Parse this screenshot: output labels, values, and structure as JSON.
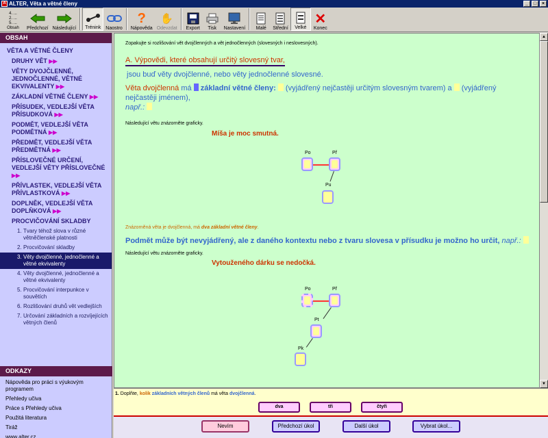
{
  "window": {
    "title": "ALTER, Věta a větné členy"
  },
  "toolbar": {
    "obsah_lines": [
      "4. ...",
      "2. ...",
      "5. ..."
    ],
    "obsah_label": "Obsah",
    "prev": "Předchozí",
    "next": "Následující",
    "trenink": "Trénink",
    "naostro": "Naostro",
    "napoveda": "Nápověda",
    "odevzdat": "Odevzdat",
    "export": "Export",
    "tisk": "Tisk",
    "nastaveni": "Nastavení",
    "male": "Malé",
    "stredni": "Střední",
    "velke": "Velké",
    "konec": "Konec"
  },
  "sidebar": {
    "header": "OBSAH",
    "items": [
      {
        "label": "VĚTA A VĚTNÉ ČLENY"
      },
      {
        "label": "DRUHY VĚT"
      },
      {
        "label": "VĚTY DVOJČLENNÉ, JEDNOČLENNÉ, VĚTNÉ EKVIVALENTY"
      },
      {
        "label": "ZÁKLADNÍ VĚTNÉ ČLENY"
      },
      {
        "label": "PŘÍSUDEK, VEDLEJŠÍ VĚTA PŘÍSUDKOVÁ"
      },
      {
        "label": "PODMĚT, VEDLEJŠÍ VĚTA PODMĚTNÁ"
      },
      {
        "label": "PŘEDMĚT, VEDLEJŠÍ VĚTA PŘEDMĚTNÁ"
      },
      {
        "label": "PŘÍSLOVEČNÉ URČENÍ, VEDLEJŠÍ VĚTY PŘÍSLOVEČNÉ"
      },
      {
        "label": "PŘÍVLASTEK, VEDLEJŠÍ VĚTA PŘÍVLASTKOVÁ"
      },
      {
        "label": "DOPLNĚK, VEDLEJŠÍ VĚTA DOPLŇKOVÁ"
      },
      {
        "label": "PROCVIČOVÁNÍ SKLADBY"
      }
    ],
    "subitems": [
      {
        "num": "1.",
        "label": "Tvary téhož slova v různé větněčlenské platnosti"
      },
      {
        "num": "2.",
        "label": "Procvičování skladby"
      },
      {
        "num": "3.",
        "label": "Věty dvojčlenné, jednočlenné a větné ekvivalenty"
      },
      {
        "num": "4.",
        "label": "Věty dvojčlenné, jednočlenné a větné ekvivalenty"
      },
      {
        "num": "5.",
        "label": "Procvičování interpunkce v souvětích"
      },
      {
        "num": "6.",
        "label": "Rozlišování druhů vět vedlejších"
      },
      {
        "num": "7.",
        "label": "Určování základních a rozvíjejících větných členů"
      }
    ],
    "odkazy_header": "ODKAZY",
    "links": [
      "Nápověda pro práci s výukovým programem",
      "Přehledy učiva",
      "Práce s Přehledy učiva",
      "Použitá literatura",
      "Tiráž",
      "www.alter.cz"
    ]
  },
  "content": {
    "intro": "Zopakujte si rozlišování vět dvojčlenných a vět jednočlenných (slovesných i neslovesných).",
    "heading": "A. Výpovědi, které obsahují určitý slovesný tvar,",
    "line1": "jsou buď věty dvojčlenné, nebo věty jednočlenné slovesné.",
    "para_red": "Věta dvojčlenná",
    "para_ma": " má ",
    "para_bold": "základní větné členy:",
    "para_t1": " (vyjádřený nejčastěji určitým slovesným tvarem) a ",
    "para_t2": " (vyjádřený nejčastěji jménem),",
    "para_napr": "např.:",
    "note1": "Následující větu znázorněte graficky.",
    "sentence1": "Míša je moc smutná.",
    "diag1": {
      "po": "Po",
      "pr": "Př",
      "pu": "Pu"
    },
    "orange_pre": "Znázorněná věta je dvojčlenná, má ",
    "orange_it": "dva základní větné členy",
    "orange_post": ".",
    "para2": "Podmět může být nevyjádřený, ale z daného kontextu nebo z tvaru slovesa v přísudku je možno ho určit,",
    "para2_napr": "např.:",
    "note2": "Následující větu znázorněte graficky.",
    "sentence2": "Vytouženého dárku se nedočká.",
    "diag2": {
      "po": "Po",
      "pr": "Př",
      "pt": "Pt",
      "pk": "Pk"
    }
  },
  "question": {
    "num": "1.",
    "t1": " Doplňte, ",
    "kolik": "kolik",
    "t2": " základních větných členů",
    "t3": " má věta ",
    "t4": "dvojčlenná",
    "t5": ".",
    "answers": [
      "dva",
      "tři",
      "čtyři"
    ]
  },
  "nav": {
    "nevim": "Nevím",
    "prev_task": "Předchozí úkol",
    "next_task": "Další úkol",
    "select_task": "Vybrat úkol..."
  }
}
